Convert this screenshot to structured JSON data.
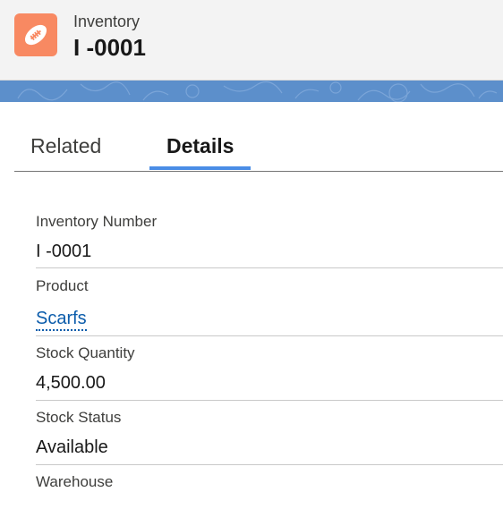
{
  "header": {
    "object_type": "Inventory",
    "record_name": "I -0001",
    "icon": "football-icon",
    "icon_color": "#f88962"
  },
  "banner": {
    "color": "#5c8fcb"
  },
  "tabs": [
    {
      "label": "Related",
      "active": false
    },
    {
      "label": "Details",
      "active": true
    }
  ],
  "accent_color": "#4a8de6",
  "fields": [
    {
      "label": "Inventory Number",
      "value": "I -0001"
    },
    {
      "label": "Product",
      "value": "Scarfs",
      "link": true
    },
    {
      "label": "Stock Quantity",
      "value": "4,500.00"
    },
    {
      "label": "Stock Status",
      "value": "Available"
    },
    {
      "label": "Warehouse",
      "value": ""
    }
  ]
}
